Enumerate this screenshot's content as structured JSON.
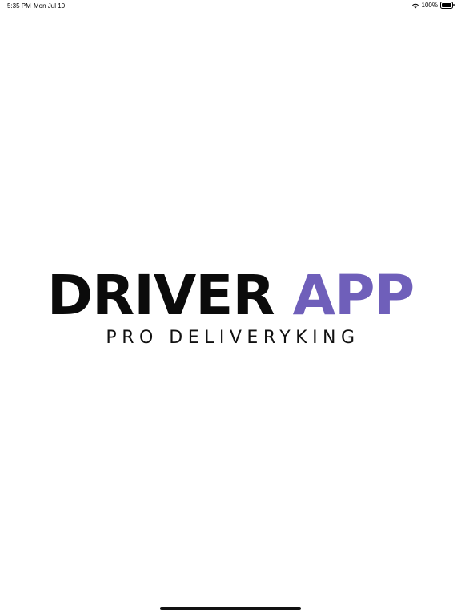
{
  "status_bar": {
    "time": "5:35 PM",
    "date": "Mon Jul 10",
    "battery": "100%",
    "wifi_icon": "wifi-icon",
    "battery_icon": "battery-icon"
  },
  "logo": {
    "word1": "DRIVER",
    "word2": "APP",
    "subtitle": "PRO DELIVERYKING"
  },
  "colors": {
    "primary_text": "#0b0b0b",
    "accent": "#6f5fba",
    "background": "#ffffff"
  }
}
